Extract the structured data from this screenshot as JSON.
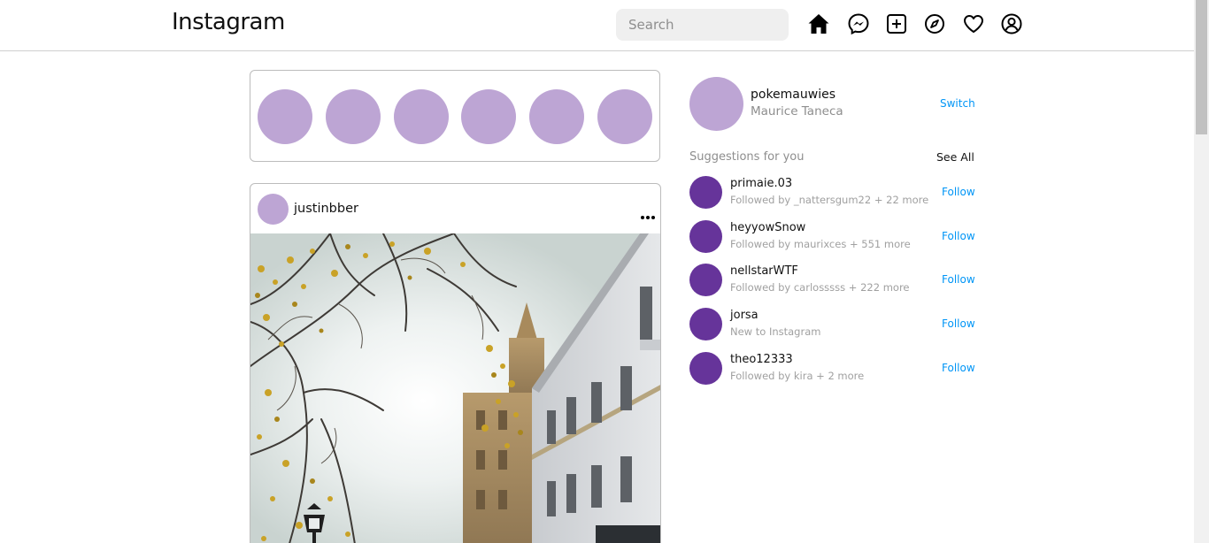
{
  "header": {
    "logo": "Instagram",
    "search_placeholder": "Search",
    "icons": [
      "home-icon",
      "messenger-icon",
      "new-post-icon",
      "explore-icon",
      "activity-heart-icon",
      "profile-icon"
    ]
  },
  "stories": {
    "count": 6,
    "avatar_color": "#bda5d4"
  },
  "post": {
    "username": "justinbber",
    "more_icon": "more-options-icon"
  },
  "sidebar": {
    "username": "pokemauwies",
    "full_name": "Maurice Taneca",
    "switch_label": "Switch",
    "suggestions_title": "Suggestions for you",
    "see_all_label": "See All",
    "suggestions": [
      {
        "username": "primaie.03",
        "subtitle": "Followed by _nattersgum22 + 22 more",
        "action": "Follow"
      },
      {
        "username": "heyyowSnow",
        "subtitle": "Followed by maurixces + 551 more",
        "action": "Follow"
      },
      {
        "username": "nellstarWTF",
        "subtitle": "Followed by carlosssss + 222 more",
        "action": "Follow"
      },
      {
        "username": "jorsa",
        "subtitle": "New to Instagram",
        "action": "Follow"
      },
      {
        "username": "theo12333",
        "subtitle": "Followed by kira + 2 more",
        "action": "Follow"
      }
    ]
  },
  "colors": {
    "accent": "#0095f6",
    "suggestion_avatar": "#66349a",
    "story_avatar": "#bda5d4"
  }
}
